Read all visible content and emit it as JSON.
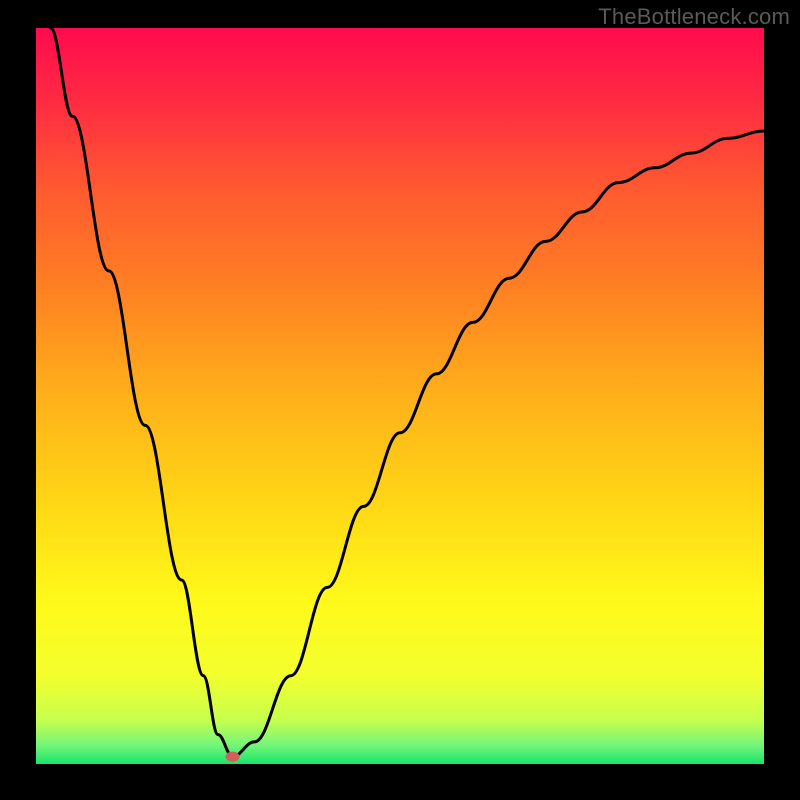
{
  "watermark": "TheBottleneck.com",
  "chart_data": {
    "type": "line",
    "title": "",
    "xlabel": "",
    "ylabel": "",
    "axes_visible": false,
    "xlim": [
      0,
      100
    ],
    "ylim": [
      0,
      100
    ],
    "series": [
      {
        "name": "curve",
        "x": [
          2,
          5,
          10,
          15,
          20,
          23,
          25,
          27,
          30,
          35,
          40,
          45,
          50,
          55,
          60,
          65,
          70,
          75,
          80,
          85,
          90,
          95,
          100
        ],
        "y": [
          100,
          88,
          67,
          46,
          25,
          12,
          4,
          1,
          3,
          12,
          24,
          35,
          45,
          53,
          60,
          66,
          71,
          75,
          79,
          81,
          83,
          85,
          86
        ]
      }
    ],
    "marker": {
      "x": 27,
      "y": 1,
      "color": "#d0605e",
      "rx": 7,
      "ry": 5
    },
    "gradient_stops": [
      {
        "offset": 0.0,
        "color": "#ff0b4d"
      },
      {
        "offset": 0.1,
        "color": "#ff2b42"
      },
      {
        "offset": 0.22,
        "color": "#ff5a30"
      },
      {
        "offset": 0.35,
        "color": "#ff7f23"
      },
      {
        "offset": 0.5,
        "color": "#ffb01a"
      },
      {
        "offset": 0.65,
        "color": "#ffd815"
      },
      {
        "offset": 0.78,
        "color": "#fff91a"
      },
      {
        "offset": 0.88,
        "color": "#f3ff2d"
      },
      {
        "offset": 0.94,
        "color": "#c7ff4d"
      },
      {
        "offset": 0.975,
        "color": "#72f57a"
      },
      {
        "offset": 1.0,
        "color": "#18e46a"
      }
    ]
  }
}
